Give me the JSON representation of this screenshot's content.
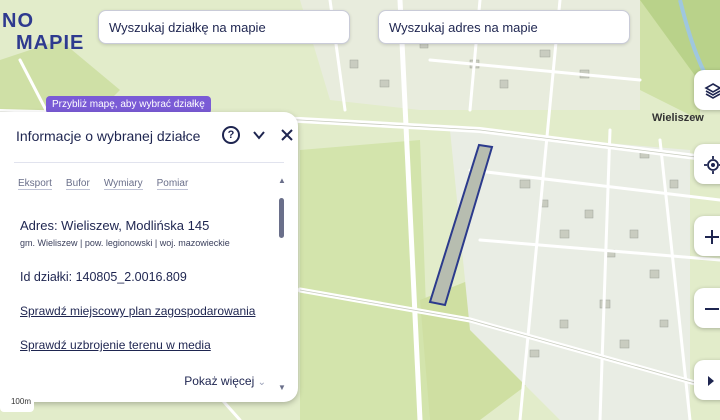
{
  "logo": {
    "line1": "NO",
    "line2": "MAPIE"
  },
  "search": {
    "plot_placeholder": "Wyszukaj działkę na mapie",
    "address_placeholder": "Wyszukaj adres na mapie"
  },
  "map": {
    "hint": "Przybliż mapę, aby wybrać działkę",
    "place_label": "Wieliszew",
    "scale_label": "100m"
  },
  "panel": {
    "title": "Informacje o wybranej działce",
    "tabs": [
      "Eksport",
      "Bufor",
      "Wymiary",
      "Pomiar"
    ],
    "address": "Adres: Wieliszew, Modlińska 145",
    "address_sub": "gm. Wieliszew | pow. legionowski | woj. mazowieckie",
    "plot_id": "Id działki: 140805_2.0016.809",
    "link_plan": "Sprawdź miejscowy plan zagospodarowania",
    "link_utilities": "Sprawdź uzbrojenie terenu w media",
    "show_more": "Pokaż więcej"
  },
  "colors": {
    "brand": "#2e3a8f",
    "hint_bg": "#7a5bd6",
    "parcel_fill": "#b7bdb0",
    "parcel_stroke": "#2b3a8c"
  },
  "icons": {
    "help": "help-icon",
    "collapse": "chevron-down-icon",
    "close": "close-icon",
    "layers": "layers-icon",
    "locate": "locate-icon",
    "zoom_in": "plus-icon",
    "zoom_out": "minus-icon",
    "expand": "chevron-right-icon"
  }
}
